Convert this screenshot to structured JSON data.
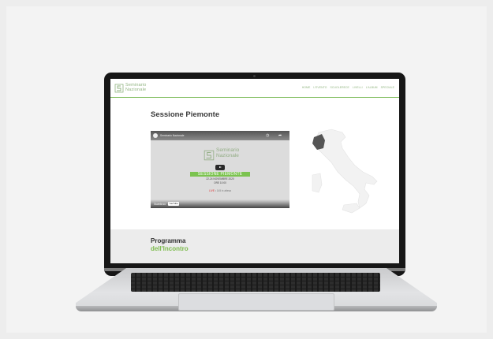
{
  "site": {
    "logo_line1": "Seminario",
    "logo_line2": "Nazionale",
    "nav": [
      "HOME",
      "L'EVENTO",
      "SCUOLERECE",
      "LIVELLI",
      "L'ALBUM",
      "SPECIALE",
      "SELEZIONA"
    ]
  },
  "page": {
    "title": "Sessione Piemonte"
  },
  "video": {
    "title": "Seminario Nazionale",
    "logo_line1": "Seminario",
    "logo_line2": "Nazionale",
    "badge": "SESSIONE PIEMONTE",
    "date": "22-24 NOVEMBRE 2020",
    "time": "ORE 10:00",
    "live_prefix": "LIVE",
    "live_text": "• 145 in attesa",
    "watch_on": "Guarda su",
    "youtube": "YouTube"
  },
  "section": {
    "line1": "Programma",
    "line2": "dell'Incontro"
  },
  "colors": {
    "accent": "#7cbb4c",
    "text_dark": "#2f2f2f",
    "band": "#ececec"
  }
}
